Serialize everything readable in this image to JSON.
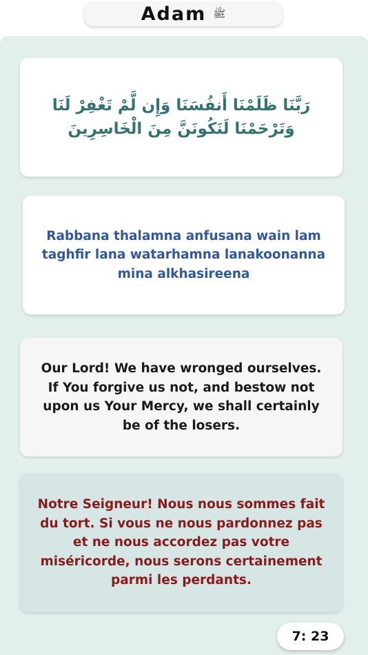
{
  "header": {
    "title": "Adam",
    "honorific": "ﷺ"
  },
  "dua": {
    "arabic": "رَبَّنَا ظَلَمْنَا أَنفُسَنَا وَإِن لَّمْ تَغْفِرْ لَنَا وَتَرْحَمْنَا لَنَكُونَنَّ مِنَ الْخَاسِرِينَ",
    "transliteration": "Rabbana thalamna anfusana wain lam taghfir lana watarhamna lanakoonanna mina alkhasireena",
    "english": "Our Lord! We have wronged ourselves. If You forgive us not, and bestow not upon us Your Mercy, we shall certainly be of the losers.",
    "french": "Notre Seigneur! Nous nous sommes fait du tort. Si vous ne nous pardonnez pas et ne nous accordez pas votre miséricorde, nous serons certainement parmi les perdants."
  },
  "verse_ref": "7: 23",
  "colors": {
    "panel_bg": "#e3efea",
    "arabic": "#2f7373",
    "transliteration": "#2f58a1",
    "english": "#1a1a1a",
    "french": "#8b1a1a",
    "french_card_bg": "#d5e6e4"
  }
}
